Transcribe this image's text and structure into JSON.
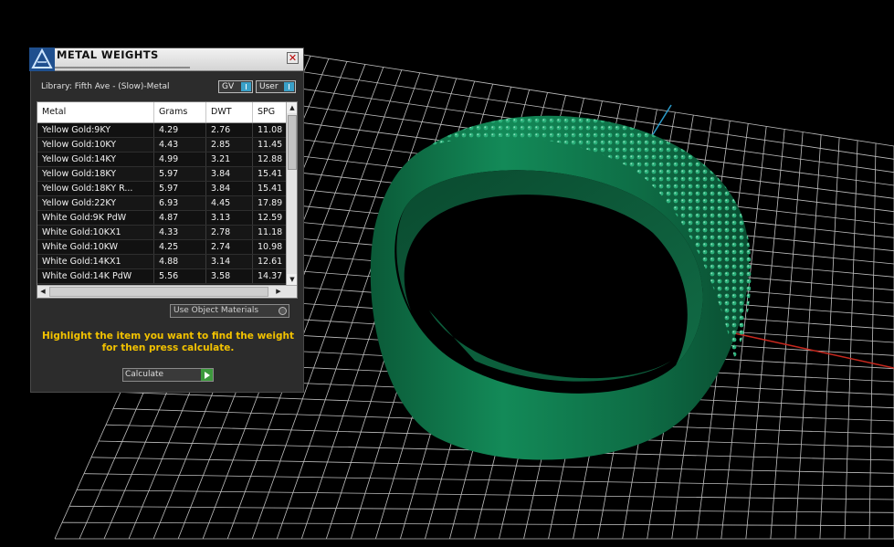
{
  "colors": {
    "background": "#000000",
    "grid": "#bfbfbf",
    "axis_red": "#c8281e",
    "axis_blue": "#2a9ac8",
    "ring_green": "#0f7a4e",
    "instruction_yellow": "#f2c200"
  },
  "panel": {
    "title": "METAL WEIGHTS",
    "logo_icon": "app-logo-icon",
    "close_label": "✕",
    "library_label": "Library: Fifth Ave - (Slow)-Metal",
    "gv_label": "GV",
    "user_label": "User",
    "columns": [
      "Metal",
      "Grams",
      "DWT",
      "SPG"
    ],
    "rows": [
      {
        "metal": "Yellow Gold:9KY",
        "grams": "4.29",
        "dwt": "2.76",
        "spg": "11.08"
      },
      {
        "metal": "Yellow Gold:10KY",
        "grams": "4.43",
        "dwt": "2.85",
        "spg": "11.45"
      },
      {
        "metal": "Yellow Gold:14KY",
        "grams": "4.99",
        "dwt": "3.21",
        "spg": "12.88"
      },
      {
        "metal": "Yellow Gold:18KY",
        "grams": "5.97",
        "dwt": "3.84",
        "spg": "15.41"
      },
      {
        "metal": "Yellow Gold:18KY R...",
        "grams": "5.97",
        "dwt": "3.84",
        "spg": "15.41"
      },
      {
        "metal": "Yellow Gold:22KY",
        "grams": "6.93",
        "dwt": "4.45",
        "spg": "17.89"
      },
      {
        "metal": "White Gold:9K PdW",
        "grams": "4.87",
        "dwt": "3.13",
        "spg": "12.59"
      },
      {
        "metal": "White Gold:10KX1",
        "grams": "4.33",
        "dwt": "2.78",
        "spg": "11.18"
      },
      {
        "metal": "White Gold:10KW",
        "grams": "4.25",
        "dwt": "2.74",
        "spg": "10.98"
      },
      {
        "metal": "White Gold:14KX1",
        "grams": "4.88",
        "dwt": "3.14",
        "spg": "12.61"
      },
      {
        "metal": "White Gold:14K PdW",
        "grams": "5.56",
        "dwt": "3.58",
        "spg": "14.37"
      }
    ],
    "use_object_materials_label": "Use Object Materials",
    "instruction": "Highlight the item you want to find the weight for then press calculate.",
    "calculate_label": "Calculate"
  }
}
